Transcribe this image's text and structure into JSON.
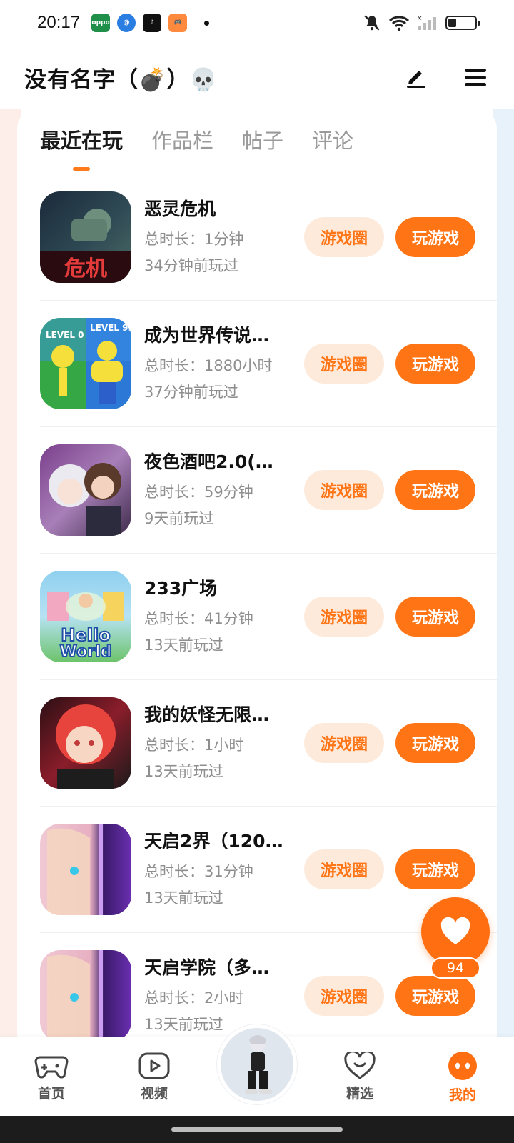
{
  "status_bar": {
    "time": "20:17",
    "apps": [
      "oppo-app",
      "at-app",
      "tiktok-app",
      "game-app"
    ],
    "battery_level": 0.3
  },
  "header": {
    "title": "没有名字（💣）💀",
    "edit_icon": "pen-icon",
    "menu_icon": "menu-icon"
  },
  "tabs": [
    {
      "label": "最近在玩",
      "active": true
    },
    {
      "label": "作品栏",
      "active": false
    },
    {
      "label": "帖子",
      "active": false
    },
    {
      "label": "评论",
      "active": false
    }
  ],
  "games": [
    {
      "name": "恶灵危机",
      "duration": "总时长：1分钟",
      "last_played": "34分钟前玩过",
      "circle_label": "游戏圈",
      "play_label": "玩游戏",
      "colors": [
        "#1b2a3a",
        "#4c6b63"
      ]
    },
    {
      "name": "成为世界传说…",
      "duration": "总时长：1880小时",
      "last_played": "37分钟前玩过",
      "circle_label": "游戏圈",
      "play_label": "玩游戏",
      "colors": [
        "#3fae4f",
        "#2b78d6"
      ]
    },
    {
      "name": "夜色酒吧2.0(…",
      "duration": "总时长：59分钟",
      "last_played": "9天前玩过",
      "circle_label": "游戏圈",
      "play_label": "玩游戏",
      "colors": [
        "#6b3d7d",
        "#c9b7d6"
      ]
    },
    {
      "name": "233广场",
      "duration": "总时长：41分钟",
      "last_played": "13天前玩过",
      "circle_label": "游戏圈",
      "play_label": "玩游戏",
      "colors": [
        "#7cc4e8",
        "#f5d04a"
      ]
    },
    {
      "name": "我的妖怪无限…",
      "duration": "总时长：1小时",
      "last_played": "13天前玩过",
      "circle_label": "游戏圈",
      "play_label": "玩游戏",
      "colors": [
        "#b5283a",
        "#f06f62"
      ]
    },
    {
      "name": "天启2界（120…",
      "duration": "总时长：31分钟",
      "last_played": "13天前玩过",
      "circle_label": "游戏圈",
      "play_label": "玩游戏",
      "colors": [
        "#e8b7c8",
        "#5b2d8f"
      ]
    },
    {
      "name": "天启学院（多…",
      "duration": "总时长：2小时",
      "last_played": "13天前玩过",
      "circle_label": "游戏圈",
      "play_label": "玩游戏",
      "colors": [
        "#e8b7c8",
        "#5b2d8f"
      ]
    }
  ],
  "fab": {
    "icon": "heart-icon",
    "count": "94"
  },
  "bottom_nav": [
    {
      "label": "首页",
      "icon": "gamepad-icon",
      "active": false
    },
    {
      "label": "视频",
      "icon": "video-icon",
      "active": false
    },
    {
      "label": "",
      "icon": "avatar",
      "active": false
    },
    {
      "label": "精选",
      "icon": "heart-badge-icon",
      "active": false
    },
    {
      "label": "我的",
      "icon": "face-icon",
      "active": true
    }
  ],
  "colors": {
    "accent": "#ff7414",
    "accent_soft": "#fdeadb"
  }
}
